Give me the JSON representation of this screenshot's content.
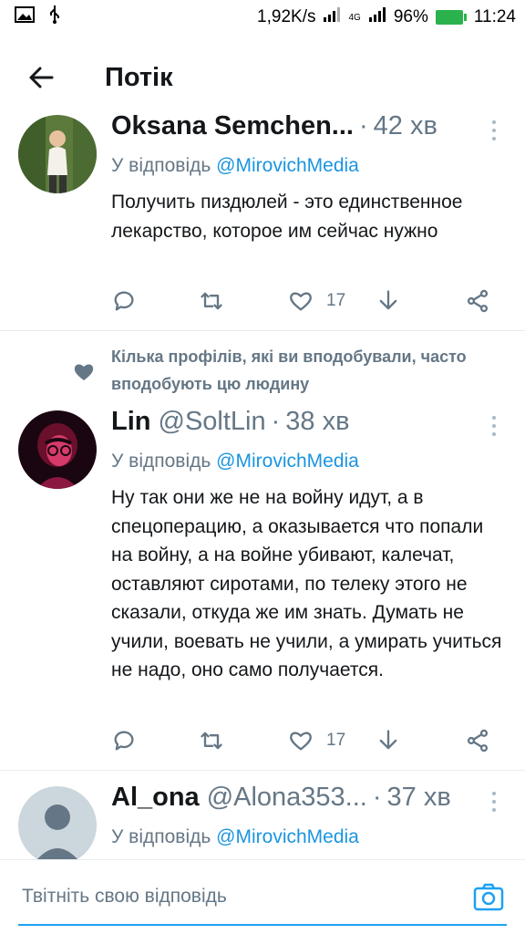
{
  "status_bar": {
    "speed": "1,92K/s",
    "network": "4G",
    "battery": "96%",
    "time": "11:24"
  },
  "header": {
    "title": "Потік"
  },
  "tweets": [
    {
      "name": "Oksana Semchen...",
      "handle": "",
      "time": "42 хв",
      "reply_prefix": "У відповідь",
      "reply_to": "@MirovichMedia",
      "text": "Получить пиздюлей - это единственное лекарство, которое им сейчас нужно",
      "likes": "17"
    },
    {
      "social_context": "Кілька профілів, які ви вподобували, часто вподобують цю людину",
      "name": "Lin",
      "handle": "@SoltLin",
      "time": "38 хв",
      "reply_prefix": "У відповідь",
      "reply_to": "@MirovichMedia",
      "text": "Ну так они же не на войну идут, а в спецоперацию, а оказывается что попали на войну, а на войне убивают, калечат, оставляют сиротами, по телеку этого не сказали, откуда же им знать. Думать не учили, воевать не учили, а умирать учиться не надо, оно само получается.",
      "likes": "17"
    },
    {
      "name": "Al_ona",
      "handle": "@Alona353...",
      "time": "37 хв",
      "reply_prefix": "У відповідь",
      "reply_to": "@MirovichMedia"
    }
  ],
  "compose": {
    "placeholder": "Твітніть свою відповідь"
  },
  "colors": {
    "accent": "#1da1f2",
    "mention": "#1b95e0",
    "muted": "#657786",
    "battery": "#2bb24c"
  }
}
